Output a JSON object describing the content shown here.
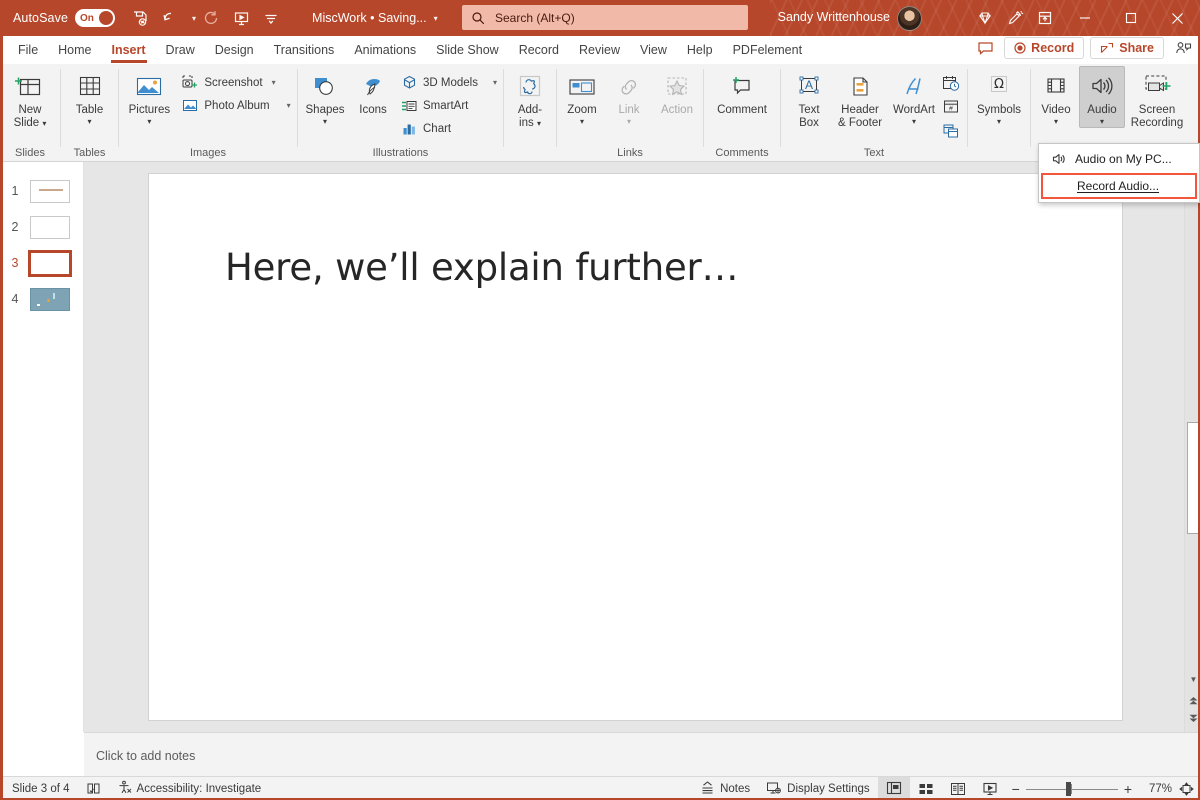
{
  "titlebar": {
    "autosave_label": "AutoSave",
    "autosave_state": "On",
    "document_title": "MiscWork • Saving...",
    "user_name": "Sandy Writtenhouse",
    "icons": [
      "save-icon",
      "undo-icon",
      "redo-icon",
      "start-presentation-icon",
      "customize-quick-access-icon"
    ],
    "window_buttons": [
      "minimize",
      "maximize",
      "close"
    ],
    "brand_color": "#b7472a"
  },
  "search": {
    "placeholder": "Search (Alt+Q)",
    "icon": "search-icon"
  },
  "tabs": [
    {
      "label": "File",
      "active": false
    },
    {
      "label": "Home",
      "active": false
    },
    {
      "label": "Insert",
      "active": true
    },
    {
      "label": "Draw",
      "active": false
    },
    {
      "label": "Design",
      "active": false
    },
    {
      "label": "Transitions",
      "active": false
    },
    {
      "label": "Animations",
      "active": false
    },
    {
      "label": "Slide Show",
      "active": false
    },
    {
      "label": "Record",
      "active": false
    },
    {
      "label": "Review",
      "active": false
    },
    {
      "label": "View",
      "active": false
    },
    {
      "label": "Help",
      "active": false
    },
    {
      "label": "PDFelement",
      "active": false
    }
  ],
  "tab_actions": {
    "comments_icon": "comment-icon",
    "record_label": "Record",
    "share_label": "Share",
    "share_person_icon": "share-person-icon"
  },
  "ribbon": {
    "groups": [
      {
        "name": "Slides",
        "label": "Slides",
        "buttons": [
          {
            "label": "New\nSlide",
            "label1": "New",
            "label2": "Slide",
            "dropdown": true,
            "icon": "new-slide-icon"
          }
        ]
      },
      {
        "name": "Tables",
        "label": "Tables",
        "buttons": [
          {
            "label1": "Table",
            "label2": "",
            "dropdown": true,
            "icon": "table-icon"
          }
        ]
      },
      {
        "name": "Images",
        "label": "Images",
        "buttons": [
          {
            "label1": "Pictures",
            "label2": "",
            "dropdown": true,
            "icon": "pictures-icon"
          }
        ],
        "small_buttons": [
          {
            "label": "Screenshot",
            "icon": "screenshot-icon",
            "dropdown": true
          },
          {
            "label": "Photo Album",
            "icon": "photo-album-icon",
            "dropdown": true
          }
        ]
      },
      {
        "name": "Illustrations",
        "label": "Illustrations",
        "buttons": [
          {
            "label1": "Shapes",
            "label2": "",
            "dropdown": true,
            "icon": "shapes-icon"
          },
          {
            "label1": "Icons",
            "label2": "",
            "dropdown": false,
            "icon": "icons-icon"
          }
        ],
        "small_buttons": [
          {
            "label": "3D Models",
            "icon": "3d-models-icon",
            "dropdown": true
          },
          {
            "label": "SmartArt",
            "icon": "smartart-icon",
            "dropdown": false
          },
          {
            "label": "Chart",
            "icon": "chart-icon",
            "dropdown": false
          }
        ]
      },
      {
        "name": "Add-ins",
        "label": "",
        "buttons": [
          {
            "label1": "Add-",
            "label2": "ins",
            "dropdown": true,
            "icon": "add-ins-icon"
          }
        ]
      },
      {
        "name": "Links",
        "label": "Links",
        "buttons": [
          {
            "label1": "Zoom",
            "label2": "",
            "dropdown": true,
            "icon": "zoom-icon"
          },
          {
            "label1": "Link",
            "label2": "",
            "dropdown": true,
            "icon": "link-icon",
            "disabled": true
          },
          {
            "label1": "Action",
            "label2": "",
            "dropdown": false,
            "icon": "action-icon",
            "disabled": true
          }
        ]
      },
      {
        "name": "Comments",
        "label": "Comments",
        "buttons": [
          {
            "label1": "Comment",
            "label2": "",
            "dropdown": false,
            "icon": "comment-add-icon"
          }
        ]
      },
      {
        "name": "Text",
        "label": "Text",
        "buttons": [
          {
            "label1": "Text",
            "label2": "Box",
            "dropdown": false,
            "icon": "text-box-icon"
          },
          {
            "label1": "Header",
            "label2": "& Footer",
            "dropdown": false,
            "icon": "header-footer-icon"
          },
          {
            "label1": "WordArt",
            "label2": "",
            "dropdown": true,
            "icon": "wordart-icon"
          }
        ],
        "mini_icons": [
          "date-time-icon",
          "slide-number-icon",
          "object-icon"
        ]
      },
      {
        "name": "Symbols",
        "label": "",
        "buttons": [
          {
            "label1": "Symbols",
            "label2": "",
            "dropdown": true,
            "icon": "symbols-icon"
          }
        ]
      },
      {
        "name": "Media",
        "label": "",
        "buttons": [
          {
            "label1": "Video",
            "label2": "",
            "dropdown": true,
            "icon": "video-icon"
          },
          {
            "label1": "Audio",
            "label2": "",
            "dropdown": true,
            "icon": "audio-icon",
            "active": true
          },
          {
            "label1": "Screen",
            "label2": "Recording",
            "dropdown": false,
            "icon": "screen-recording-icon"
          }
        ]
      }
    ]
  },
  "audio_menu": {
    "items": [
      {
        "label": "Audio on My PC...",
        "icon": "speaker-icon",
        "highlighted": false,
        "accesskey": "P"
      },
      {
        "label": "Record Audio...",
        "icon": "",
        "highlighted": true,
        "accesskey": "R"
      }
    ],
    "highlight_color": "#f4553d"
  },
  "slides_panel": {
    "slides": [
      {
        "number": "1",
        "selected": false,
        "has_text": true,
        "fill": "#ffffff"
      },
      {
        "number": "2",
        "selected": false,
        "has_text": false,
        "fill": "#ffffff"
      },
      {
        "number": "3",
        "selected": true,
        "has_text": false,
        "fill": "#ffffff"
      },
      {
        "number": "4",
        "selected": false,
        "has_text": false,
        "fill": "#7da3b5"
      }
    ]
  },
  "slide": {
    "title_text": "Here, we’ll explain further…"
  },
  "notes": {
    "placeholder": "Click to add notes"
  },
  "statusbar": {
    "slide_indicator": "Slide 3 of 4",
    "language_icon": "spellcheck-icon",
    "accessibility_label": "Accessibility: Investigate",
    "accessibility_icon": "accessibility-icon",
    "notes_label": "Notes",
    "notes_icon": "notes-icon",
    "display_settings_label": "Display Settings",
    "display_settings_icon": "display-settings-icon",
    "views": [
      {
        "name": "normal-view",
        "active": true
      },
      {
        "name": "slide-sorter-view",
        "active": false
      },
      {
        "name": "reading-view",
        "active": false
      },
      {
        "name": "slide-show-view",
        "active": false
      }
    ],
    "zoom_out_label": "−",
    "zoom_in_label": "+",
    "zoom_percent": "77%",
    "fit_slide_icon": "fit-to-window-icon"
  }
}
